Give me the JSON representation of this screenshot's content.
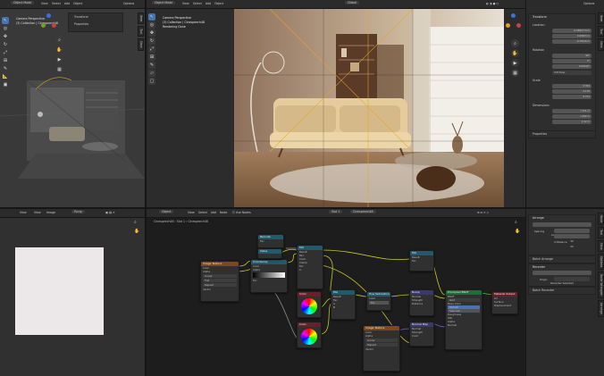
{
  "top_left": {
    "editor": "Object Mode",
    "menus": [
      "View",
      "Select",
      "Add",
      "Object"
    ],
    "cam_name": "Camera Perspective",
    "cam_collection": "(3) Collection | Cinespeech48",
    "outliner": [
      "Transform",
      "Properties"
    ],
    "options": "Options"
  },
  "top_center": {
    "editor": "Object Mode",
    "menus": [
      "View",
      "Select",
      "Add",
      "Object"
    ],
    "global": "Global",
    "cam_name": "Camera Perspective",
    "cam_collection": "(3) Collection | Cinespeech48",
    "status": "Rendering Done"
  },
  "right_panel": {
    "options": "Options",
    "transform": "Transform",
    "location": "Location",
    "loc": [
      "-0.0681574 m",
      "0.08463 m",
      "-0.76419 m"
    ],
    "rotation": "Rotation",
    "rot": [
      "90°",
      "0°",
      "0.00018°"
    ],
    "rot_mode": "XYZ Euler",
    "scale": "Scale",
    "scl": [
      "0.304",
      "0.178",
      "0.724"
    ],
    "dimensions": "Dimensions",
    "dim": [
      "1.231 m",
      "1.832 m",
      "2.42 m"
    ],
    "properties": "Properties",
    "tabs": [
      "Item",
      "Tool",
      "View"
    ]
  },
  "bottom_left": {
    "menus": [
      "View",
      "View",
      "Image"
    ],
    "image_name": "P.png"
  },
  "node_editor": {
    "editor": "Object",
    "menus": [
      "View",
      "Select",
      "Add",
      "Node"
    ],
    "use_nodes": "Use Nodes",
    "slot": "Slot 1",
    "material": "Cinespeech48",
    "breadcrumb": [
      "Cinespeech48",
      "Slot 1",
      "Cinespeech48"
    ]
  },
  "side_panel": {
    "arrange": "Arrange",
    "arrange_selected": "Arrange Selected",
    "spacing": "Spacing",
    "spacing_x": "50",
    "spacing_y": "50",
    "balance": "Balance",
    "batch_arrange": "Batch Arrange",
    "recenter": "Recenter",
    "recenter_selected": "Recenter Selected",
    "origin": "Origin",
    "origin_val": "Center",
    "batch_recenter": "Batch Recenter",
    "tabs": [
      "Node",
      "Tool",
      "View",
      "Options",
      "Node Wrangler",
      "Arrange"
    ]
  },
  "nodes": [
    {
      "id": "tex",
      "title": "Image Texture",
      "color": "#7a4a1c",
      "rows": [
        "Color",
        "Alpha",
        "",
        "Linear",
        "Flat",
        "Repeat",
        "Single Image",
        "Vector"
      ]
    },
    {
      "id": "ramp",
      "title": "ColorRamp",
      "color": "#1f5b6b",
      "rows": [
        "Color",
        "Alpha",
        "RGB",
        "Linear",
        "",
        "Pos 0.000",
        "Fac"
      ]
    },
    {
      "id": "mix1",
      "title": "Mix",
      "color": "#1f5b6b",
      "rows": [
        "Result",
        "Mix",
        "Color",
        "Clamp",
        "Fac",
        "A",
        "B"
      ]
    },
    {
      "id": "mix2",
      "title": "Mix",
      "color": "#1f5b6b",
      "rows": [
        "Result",
        "Mix",
        "Fac",
        "A",
        "B"
      ]
    },
    {
      "id": "hue",
      "title": "Hue Saturation",
      "color": "#1f5b6b",
      "rows": [
        "Color",
        "Hue",
        "Saturation",
        "Value",
        "Fac"
      ]
    },
    {
      "id": "cw1",
      "title": "Color",
      "color": "#6b1f2a",
      "rows": [
        "Color"
      ]
    },
    {
      "id": "cw2",
      "title": "Color",
      "color": "#6b1f2a",
      "rows": [
        "Color"
      ]
    },
    {
      "id": "mix3",
      "title": "Mix",
      "color": "#1f5b6b",
      "rows": [
        "Result",
        "Mix",
        "Fac",
        "A"
      ]
    },
    {
      "id": "bump",
      "title": "Bump",
      "color": "#3a3a6a",
      "rows": [
        "Normal",
        "Invert",
        "Strength",
        "Distance",
        "Height"
      ]
    },
    {
      "id": "vec",
      "title": "Mapping",
      "color": "#3a3a6a",
      "rows": [
        "Vector",
        "Point",
        "Location",
        "Rotation",
        "Scale"
      ]
    },
    {
      "id": "bsdf",
      "title": "Principled BSDF",
      "color": "#1f6b3a",
      "rows": [
        "BSDF",
        "GGX",
        "Random Walk",
        "Base Color",
        "Subsurface",
        "Radius",
        "Metallic",
        "Specular",
        "Roughness",
        "Anisotropic",
        "Sheen",
        "Clearcoat",
        "IOR",
        "Emission",
        "Alpha",
        "Normal"
      ]
    },
    {
      "id": "out",
      "title": "Material Output",
      "color": "#6b1f2a",
      "rows": [
        "All",
        "Surface",
        "Volume",
        "Displacement"
      ]
    },
    {
      "id": "norm",
      "title": "Normal Map",
      "color": "#3a3a6a",
      "rows": [
        "Normal",
        "Tangent Space",
        "Strength",
        "Color"
      ]
    },
    {
      "id": "disp",
      "title": "Image Texture",
      "color": "#7a4a1c",
      "rows": [
        "Color",
        "Alpha",
        "Linear",
        "Repeat",
        "Vector"
      ]
    },
    {
      "id": "r1",
      "title": "Reroute",
      "color": "#1f5b6b",
      "rows": [
        "Fac",
        "Color"
      ]
    },
    {
      "id": "r2",
      "title": "Value",
      "color": "#1f5b6b",
      "rows": [
        "Value"
      ]
    }
  ]
}
